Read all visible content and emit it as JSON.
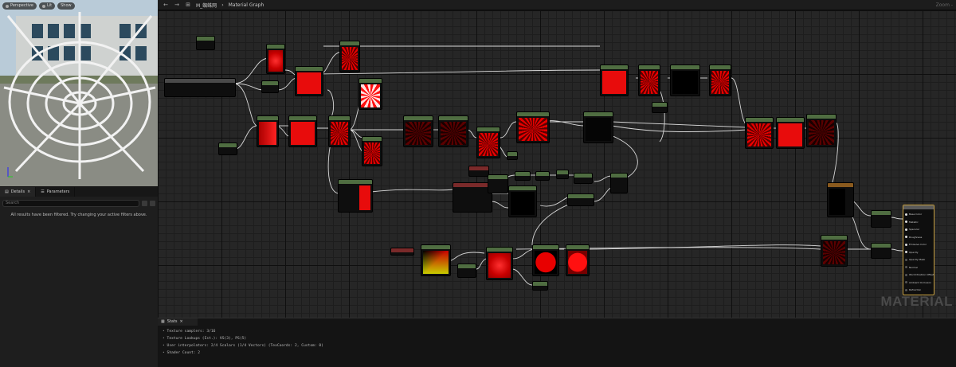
{
  "viewport": {
    "toolbar": [
      "Perspective",
      "Lit",
      "Show"
    ]
  },
  "left_panel": {
    "tabs": [
      "Details",
      "Parameters"
    ],
    "search_placeholder": "Search",
    "filter_message": "All results have been filtered. Try changing your active filters above."
  },
  "topbar": {
    "breadcrumb": [
      "M_蜘蛛网",
      "Material Graph"
    ],
    "zoom": "Zoom -"
  },
  "graph": {
    "watermark": "MATERIAL",
    "output_pins": [
      "Base Color",
      "Metallic",
      "Specular",
      "Roughness",
      "Emissive Color",
      "Opacity",
      "Opacity Mask",
      "Normal",
      "World Position Offset",
      "Ambient Occlusion",
      "Refraction"
    ]
  },
  "stats": {
    "tab_label": "Stats",
    "lines": [
      "Texture samplers: 3/16",
      "Texture Lookups (Est.): VS(3), PS(5)",
      "User interpolators: 2/4 Scalars (1/4 Vectors) (TexCoords: 2, Custom: 0)",
      "Shader Count: 2"
    ]
  },
  "colors": {
    "accent_red": "#e80c0c",
    "node_header_green": "#5d7a58",
    "node_header_red": "#7a2a2a",
    "node_header_orange": "#8a5a1e",
    "graph_bg": "#262626"
  }
}
